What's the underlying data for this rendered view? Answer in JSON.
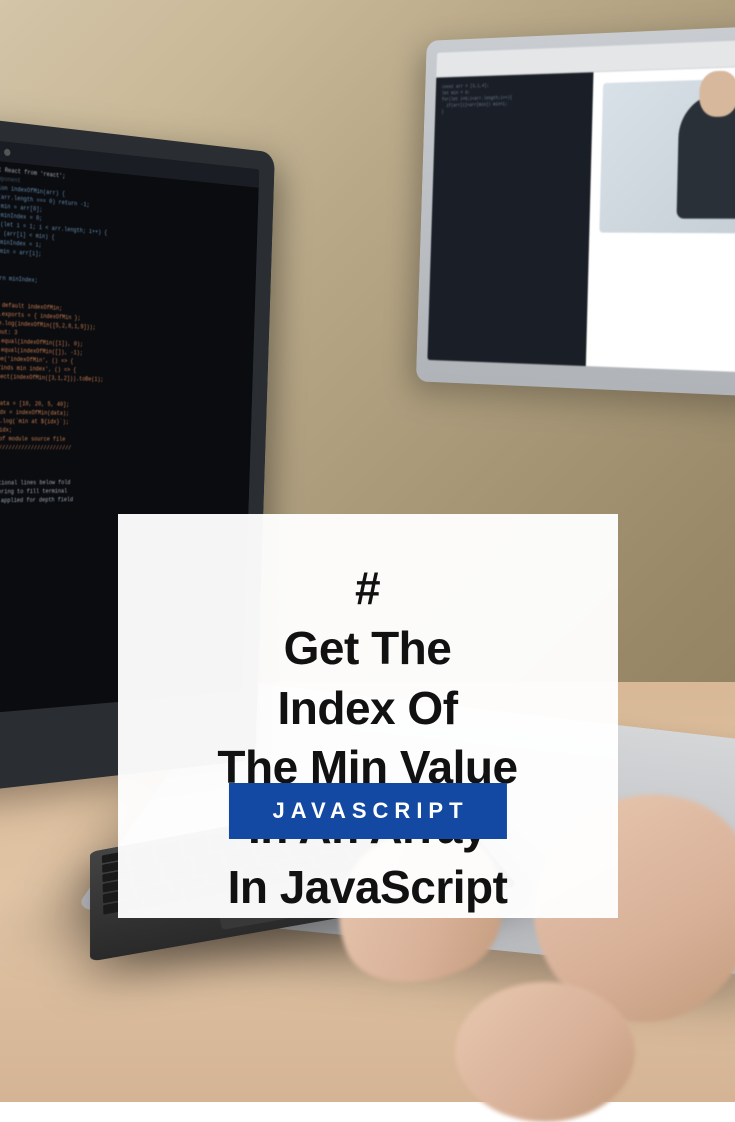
{
  "title_lines": [
    "#",
    "Get The",
    "Index Of",
    "The Min Value",
    "In An Array",
    "In JavaScript"
  ],
  "badge": "JAVASCRIPT"
}
